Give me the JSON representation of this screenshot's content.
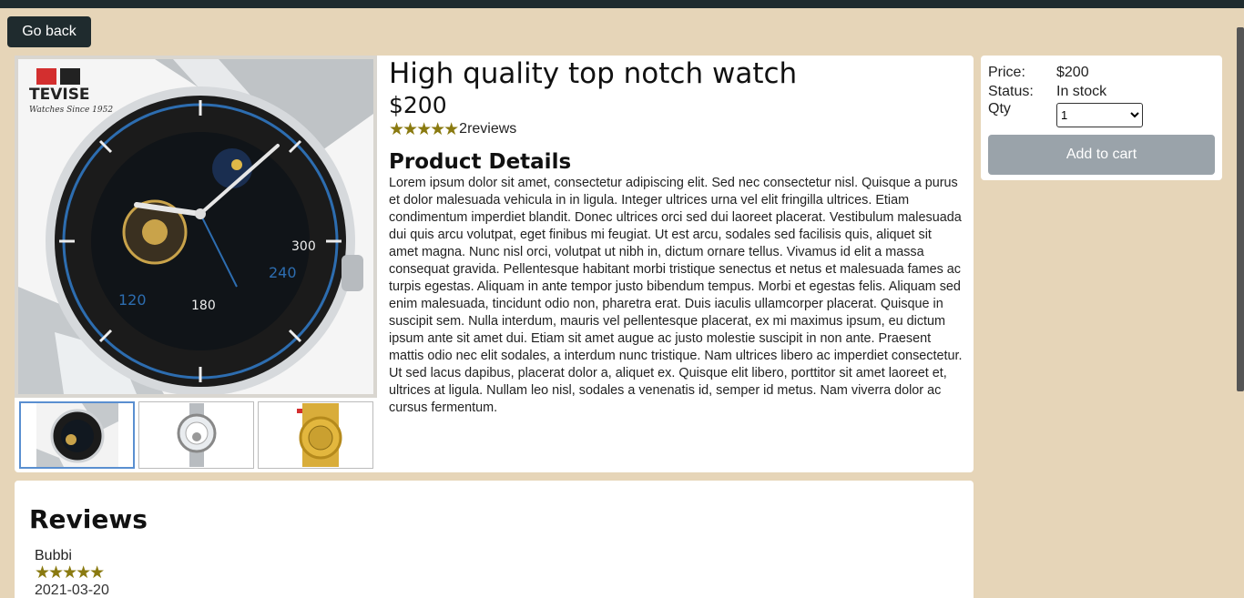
{
  "nav": {
    "back_label": "Go back"
  },
  "product": {
    "title": "High quality top notch watch",
    "price": "$200",
    "stars": "★★★★★",
    "reviews_count": "2reviews",
    "details_title": "Product Details",
    "details_text": "Lorem ipsum dolor sit amet, consectetur adipiscing elit. Sed nec consectetur nisl. Quisque a purus et dolor malesuada vehicula in in ligula. Integer ultrices urna vel elit fringilla ultrices. Etiam condimentum imperdiet blandit. Donec ultrices orci sed dui laoreet placerat. Vestibulum malesuada dui quis arcu volutpat, eget finibus mi feugiat. Ut est arcu, sodales sed facilisis quis, aliquet sit amet magna. Nunc nisl orci, volutpat ut nibh in, dictum ornare tellus. Vivamus id elit a massa consequat gravida. Pellentesque habitant morbi tristique senectus et netus et malesuada fames ac turpis egestas. Aliquam in ante tempor justo bibendum tempus. Morbi et egestas felis. Aliquam sed enim malesuada, tincidunt odio non, pharetra erat. Duis iaculis ullamcorper placerat. Quisque in suscipit sem. Nulla interdum, mauris vel pellentesque placerat, ex mi maximus ipsum, eu dictum ipsum ante sit amet dui. Etiam sit amet augue ac justo molestie suscipit in non ante. Praesent mattis odio nec elit sodales, a interdum nunc tristique. Nam ultrices libero ac imperdiet consectetur. Ut sed lacus dapibus, placerat dolor a, aliquet ex. Quisque elit libero, porttitor sit amet laoreet et, ultrices at ligula. Nullam leo nisl, sodales a venenatis id, semper id metus. Nam viverra dolor ac cursus fermentum.",
    "brand_logo": "TEVISE",
    "brand_tagline": "Watches Since 1952"
  },
  "buy": {
    "price_label": "Price:",
    "price_value": "$200",
    "status_label": "Status:",
    "status_value": "In stock",
    "qty_label": "Qty",
    "qty_value": "1",
    "add_label": "Add to cart"
  },
  "reviews": {
    "title": "Reviews",
    "items": [
      {
        "author": "Bubbi",
        "stars": "★★★★★",
        "date": "2021-03-20"
      }
    ]
  },
  "colors": {
    "topbar": "#1f2b2e",
    "background": "#e6d5b8",
    "star": "#8a7a10",
    "add_button": "#9aa3aa"
  }
}
